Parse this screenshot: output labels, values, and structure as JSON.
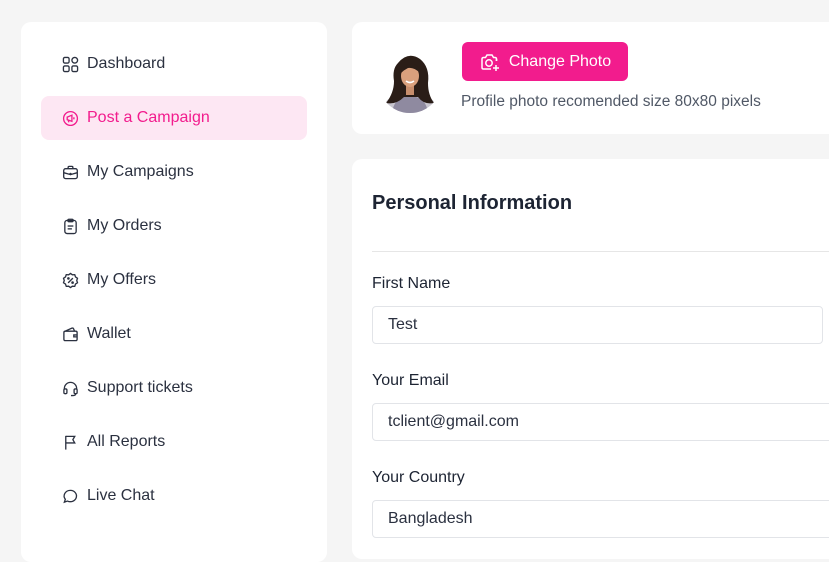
{
  "sidebar": {
    "items": [
      {
        "label": "Dashboard",
        "icon": "grid-icon"
      },
      {
        "label": "Post a Campaign",
        "icon": "megaphone-icon",
        "active": true
      },
      {
        "label": "My Campaigns",
        "icon": "briefcase-icon"
      },
      {
        "label": "My Orders",
        "icon": "clipboard-icon"
      },
      {
        "label": "My Offers",
        "icon": "badge-percent-icon"
      },
      {
        "label": "Wallet",
        "icon": "wallet-icon"
      },
      {
        "label": "Support tickets",
        "icon": "headset-icon"
      },
      {
        "label": "All Reports",
        "icon": "flag-icon"
      },
      {
        "label": "Live Chat",
        "icon": "chat-bubble-icon"
      }
    ]
  },
  "profile_photo": {
    "button_label": "Change Photo",
    "hint": "Profile photo recomended size 80x80 pixels"
  },
  "personal_info": {
    "title": "Personal Information",
    "first_name": {
      "label": "First Name",
      "value": "Test"
    },
    "email": {
      "label": "Your Email",
      "value": "tclient@gmail.com"
    },
    "country": {
      "label": "Your Country",
      "value": "Bangladesh"
    }
  },
  "colors": {
    "accent": "#f21c8d",
    "active_bg": "#fde7f3",
    "page_bg": "#f5f5f5"
  }
}
